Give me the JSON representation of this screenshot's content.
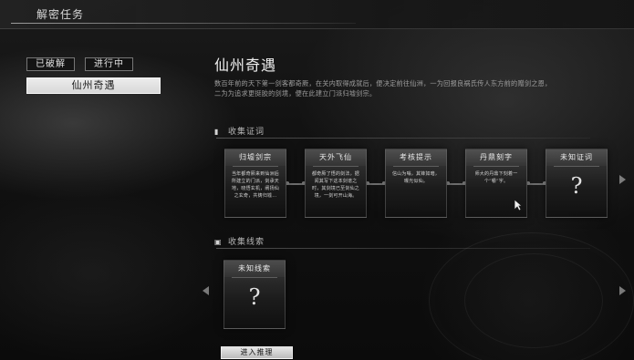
{
  "screen": {
    "title": "解密任务"
  },
  "filters": {
    "cracked": "已破解",
    "in_progress": "进行中",
    "selected_task": "仙州奇遇"
  },
  "detail": {
    "title": "仙州奇遇",
    "description": "数百年前的天下第一剑客都奇厥，在关内取得成就后，便决定前往仙洲，一为回报良祸氏传人东方前的赠剑之恩，二为为追求更挺胶的剑境，便在此建立门派归墟剑宗。"
  },
  "sections": {
    "evidence": {
      "icon": "scroll-icon",
      "label": "收集证词"
    },
    "clues": {
      "icon": "treasure-chest-icon",
      "label": "收集线索"
    }
  },
  "evidence_cards": [
    {
      "title": "归墟剑宗",
      "text": "当年都奇厥来到仙洲后所建立的门派，剑承天地，晓悟玄机，阐扬仙之玄奇，共铸归墟…"
    },
    {
      "title": "天外飞仙",
      "text": "都奇厥了悟的剑法，据闻其写下这本剑谱之时，其剑境已至剑仙之境，一剑可开山海。"
    },
    {
      "title": "考核提示",
      "text": "信山为嗡，其锋如暗，曝光似仙。"
    },
    {
      "title": "丹鼎刻字",
      "text": "师大的丹鼎下刻着一个“嚼”字。"
    },
    {
      "title": "未知证词",
      "text": "?"
    }
  ],
  "clue_cards": [
    {
      "title": "未知线索",
      "text": "?"
    }
  ],
  "actions": {
    "enter_reasoning": "进入推理"
  }
}
